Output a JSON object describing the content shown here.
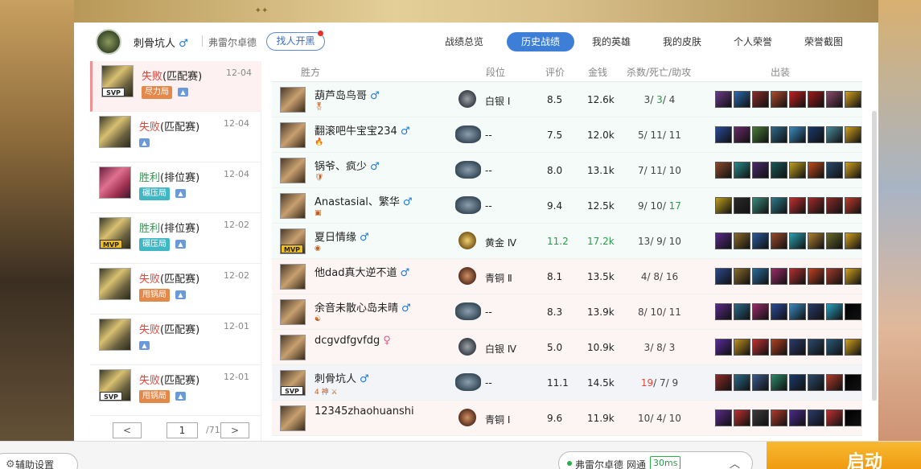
{
  "player": {
    "name": "刺骨坑人",
    "gender_icon": "♂",
    "server": "弗雷尔卓德",
    "find_button": "找人开黑"
  },
  "tabs": [
    {
      "label": "战绩总览",
      "active": false
    },
    {
      "label": "历史战绩",
      "active": true
    },
    {
      "label": "我的英雄",
      "active": false
    },
    {
      "label": "我的皮肤",
      "active": false
    },
    {
      "label": "个人荣誉",
      "active": false
    },
    {
      "label": "荣誉截图",
      "active": false
    }
  ],
  "matches": [
    {
      "result": "失败",
      "mode": "(匹配赛)",
      "date": "12-04",
      "tag": "尽力局",
      "tag_color": "#e5894a",
      "badge": "SVP",
      "champ": "robot"
    },
    {
      "result": "失败",
      "mode": "(匹配赛)",
      "date": "12-04",
      "tag": "",
      "badge": "",
      "champ": "robot"
    },
    {
      "result": "胜利",
      "mode": "(排位赛)",
      "date": "12-04",
      "tag": "碾压局",
      "tag_color": "#3fb7c4",
      "badge": "",
      "champ": "vi"
    },
    {
      "result": "胜利",
      "mode": "(排位赛)",
      "date": "12-02",
      "tag": "碾压局",
      "tag_color": "#3fb7c4",
      "badge": "MVP",
      "champ": "robot"
    },
    {
      "result": "失败",
      "mode": "(匹配赛)",
      "date": "12-02",
      "tag": "甩锅局",
      "tag_color": "#e5894a",
      "badge": "",
      "champ": "robot"
    },
    {
      "result": "失败",
      "mode": "(匹配赛)",
      "date": "12-01",
      "tag": "",
      "badge": "",
      "champ": "robot"
    },
    {
      "result": "失败",
      "mode": "(匹配赛)",
      "date": "12-01",
      "tag": "甩锅局",
      "tag_color": "#e5894a",
      "badge": "SVP",
      "champ": "robot"
    }
  ],
  "pager": {
    "prev": "<",
    "next": ">",
    "current": "1",
    "total": "/71"
  },
  "table": {
    "headers": {
      "side": "胜方",
      "rank": "段位",
      "score": "评价",
      "gold": "金钱",
      "kda": "杀数/死亡/助攻",
      "items": "出装"
    },
    "rows": [
      {
        "name": "葫芦岛鸟哥",
        "gender": "♂",
        "sub": "🎖",
        "rank": "白银 Ⅰ",
        "emblem": "silver",
        "score": "8.5",
        "gold": "12.6k",
        "k": "3",
        "d": "3",
        "a": "4",
        "d_green": true,
        "side": "win"
      },
      {
        "name": "翻滚吧牛宝宝234",
        "gender": "♂",
        "sub": "🔥",
        "rank": "--",
        "emblem": "wide",
        "score": "7.5",
        "gold": "12.0k",
        "k": "5",
        "d": "11",
        "a": "11",
        "side": "win"
      },
      {
        "name": "锅爷、疯少",
        "gender": "♂",
        "sub": "🛡",
        "rank": "--",
        "emblem": "wide",
        "score": "8.0",
        "gold": "13.1k",
        "k": "7",
        "d": "11",
        "a": "10",
        "side": "win"
      },
      {
        "name": "Anastasial、繁华",
        "gender": "♂",
        "sub": "▣",
        "rank": "--",
        "emblem": "wide",
        "score": "9.4",
        "gold": "12.5k",
        "k": "9",
        "d": "10",
        "a": "17",
        "a_green": true,
        "side": "win"
      },
      {
        "name": "夏日情缘",
        "gender": "♂",
        "sub": "◉",
        "rank": "黄金 Ⅳ",
        "emblem": "gold",
        "score": "11.2",
        "gold": "17.2k",
        "k": "13",
        "d": "9",
        "a": "10",
        "score_green": true,
        "gold_green": true,
        "badge": "MVP",
        "side": "win"
      },
      {
        "name": "他dad真大逆不道",
        "gender": "♂",
        "sub": "",
        "rank": "青铜 Ⅱ",
        "emblem": "bronze",
        "score": "8.1",
        "gold": "13.5k",
        "k": "4",
        "d": "8",
        "a": "16",
        "side": "lose"
      },
      {
        "name": "余音未散心岛未晴",
        "gender": "♂",
        "sub": "☯",
        "rank": "--",
        "emblem": "wide",
        "score": "8.3",
        "gold": "13.9k",
        "k": "8",
        "d": "10",
        "a": "11",
        "side": "lose"
      },
      {
        "name": "dcgvdfgvfdg",
        "gender": "♀",
        "sub": "",
        "rank": "白银 Ⅳ",
        "emblem": "silver",
        "score": "5.0",
        "gold": "10.9k",
        "k": "3",
        "d": "8",
        "a": "3",
        "side": "lose"
      },
      {
        "name": "刺骨坑人",
        "gender": "♂",
        "sub": "4 神 ⚔",
        "rank": "--",
        "emblem": "wide",
        "score": "11.1",
        "gold": "14.5k",
        "k": "19",
        "d": "7",
        "a": "9",
        "k_red": true,
        "badge": "SVP",
        "side": "self"
      },
      {
        "name": "12345zhaohuanshi",
        "gender": "",
        "sub": "",
        "rank": "青铜 Ⅰ",
        "emblem": "bronze",
        "score": "9.6",
        "gold": "11.9k",
        "k": "10",
        "d": "4",
        "a": "10",
        "side": "lose"
      }
    ]
  },
  "bottom": {
    "assist": "辅助设置",
    "server_status": "弗雷尔卓德 网通",
    "ping": "30ms",
    "launch": "启动"
  }
}
